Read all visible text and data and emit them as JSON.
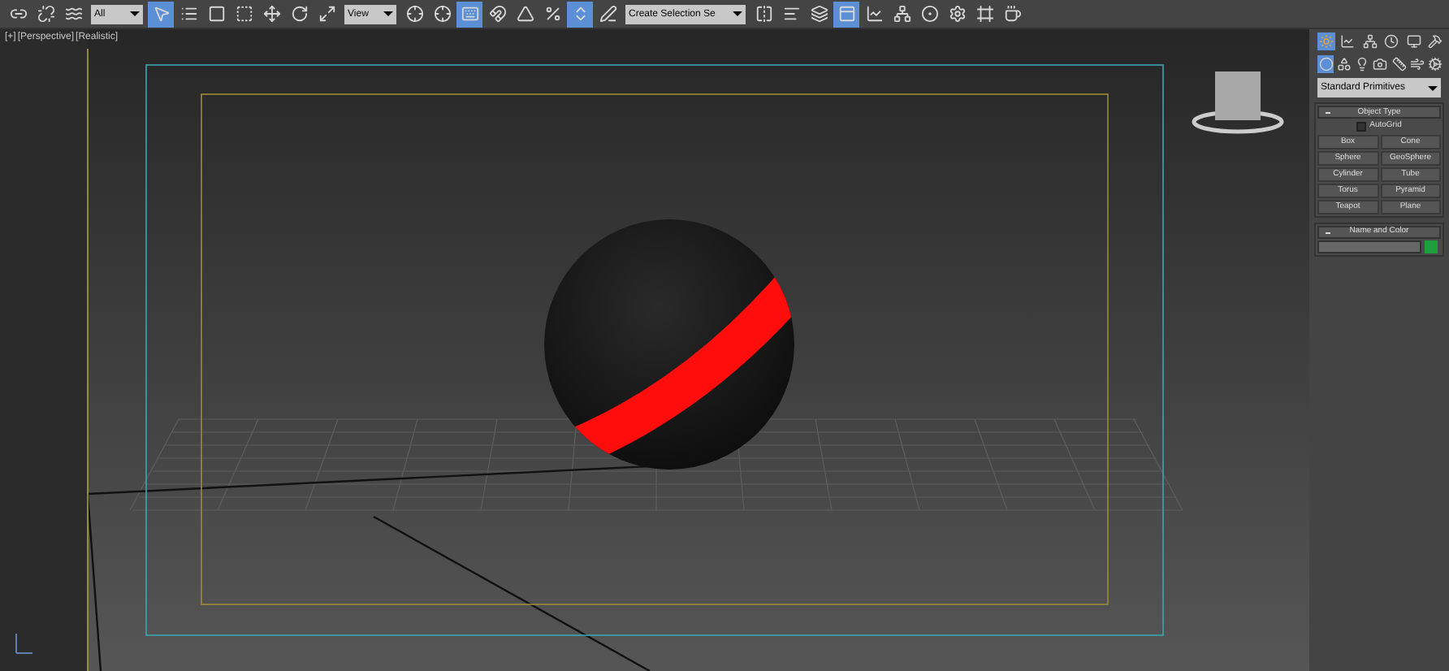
{
  "toolbar": {
    "selection_filter": "All",
    "reference_coord": "View",
    "named_selection": "Create Selection Se",
    "tools": [
      {
        "kind": "link",
        "selected": false
      },
      {
        "kind": "unlink",
        "selected": false
      },
      {
        "kind": "bind",
        "selected": false
      },
      {
        "kind": "filter"
      },
      {
        "kind": "select",
        "selected": true
      },
      {
        "kind": "select-name",
        "selected": false
      },
      {
        "kind": "region",
        "selected": false
      },
      {
        "kind": "window",
        "selected": false
      },
      {
        "kind": "move",
        "selected": false
      },
      {
        "kind": "rotate",
        "selected": false
      },
      {
        "kind": "scale",
        "selected": false
      },
      {
        "kind": "coord"
      },
      {
        "kind": "pivot",
        "selected": false
      },
      {
        "kind": "manipulate",
        "selected": false
      },
      {
        "kind": "keyboard",
        "selected": true
      },
      {
        "kind": "snap",
        "selected": false
      },
      {
        "kind": "angle-snap",
        "selected": false
      },
      {
        "kind": "percent-snap",
        "selected": false
      },
      {
        "kind": "spinner-snap",
        "selected": true
      },
      {
        "kind": "edit-named",
        "selected": false
      },
      {
        "kind": "named"
      },
      {
        "kind": "mirror",
        "selected": false
      },
      {
        "kind": "align",
        "selected": false
      },
      {
        "kind": "layers",
        "selected": false
      },
      {
        "kind": "ribbon",
        "selected": true
      },
      {
        "kind": "curve",
        "selected": false
      },
      {
        "kind": "schematic",
        "selected": false
      },
      {
        "kind": "material",
        "selected": false
      },
      {
        "kind": "render-setup",
        "selected": false
      },
      {
        "kind": "frame",
        "selected": false
      },
      {
        "kind": "render",
        "selected": false
      }
    ]
  },
  "viewport": {
    "labels": [
      "[+]",
      "[Perspective]",
      "[Realistic]"
    ]
  },
  "command_panel": {
    "tabs": [
      {
        "kind": "create",
        "selected": true
      },
      {
        "kind": "modify",
        "selected": false
      },
      {
        "kind": "hierarchy",
        "selected": false
      },
      {
        "kind": "motion",
        "selected": false
      },
      {
        "kind": "display",
        "selected": false
      },
      {
        "kind": "utilities",
        "selected": false
      }
    ],
    "subtabs": [
      {
        "kind": "geometry",
        "selected": true
      },
      {
        "kind": "shapes",
        "selected": false
      },
      {
        "kind": "lights",
        "selected": false
      },
      {
        "kind": "cameras",
        "selected": false
      },
      {
        "kind": "helpers",
        "selected": false
      },
      {
        "kind": "spacewarps",
        "selected": false
      },
      {
        "kind": "systems",
        "selected": false
      }
    ],
    "category": "Standard Primitives",
    "object_type": {
      "title": "Object Type",
      "expanded": true,
      "autogrid": {
        "label": "AutoGrid",
        "checked": false
      },
      "buttons": [
        "Box",
        "Cone",
        "Sphere",
        "GeoSphere",
        "Cylinder",
        "Tube",
        "Torus",
        "Pyramid",
        "Teapot",
        "Plane"
      ]
    },
    "name_and_color": {
      "title": "Name and Color",
      "expanded": true,
      "color": "#1f9e3c"
    }
  }
}
